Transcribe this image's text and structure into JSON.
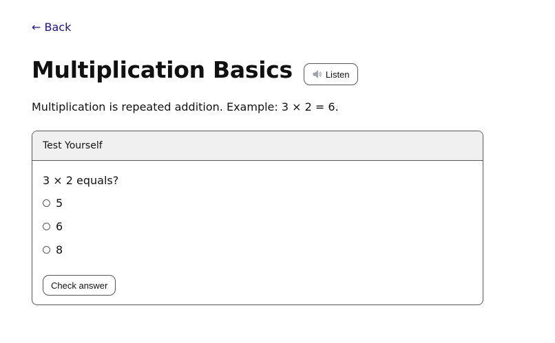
{
  "nav": {
    "back_label": "← Back"
  },
  "lesson": {
    "title": "Multiplication Basics",
    "listen_label": "Listen",
    "intro": "Multiplication is repeated addition. Example: 3 × 2 = 6."
  },
  "quiz": {
    "header": "Test Yourself",
    "question": "3 × 2 equals?",
    "options": [
      {
        "label": "5"
      },
      {
        "label": "6"
      },
      {
        "label": "8"
      }
    ],
    "check_label": "Check answer"
  },
  "icons": {
    "listen": "speaker-icon"
  },
  "colors": {
    "link": "#1a0dab",
    "panel_header_bg": "#f0f0f0",
    "border": "#555555"
  }
}
